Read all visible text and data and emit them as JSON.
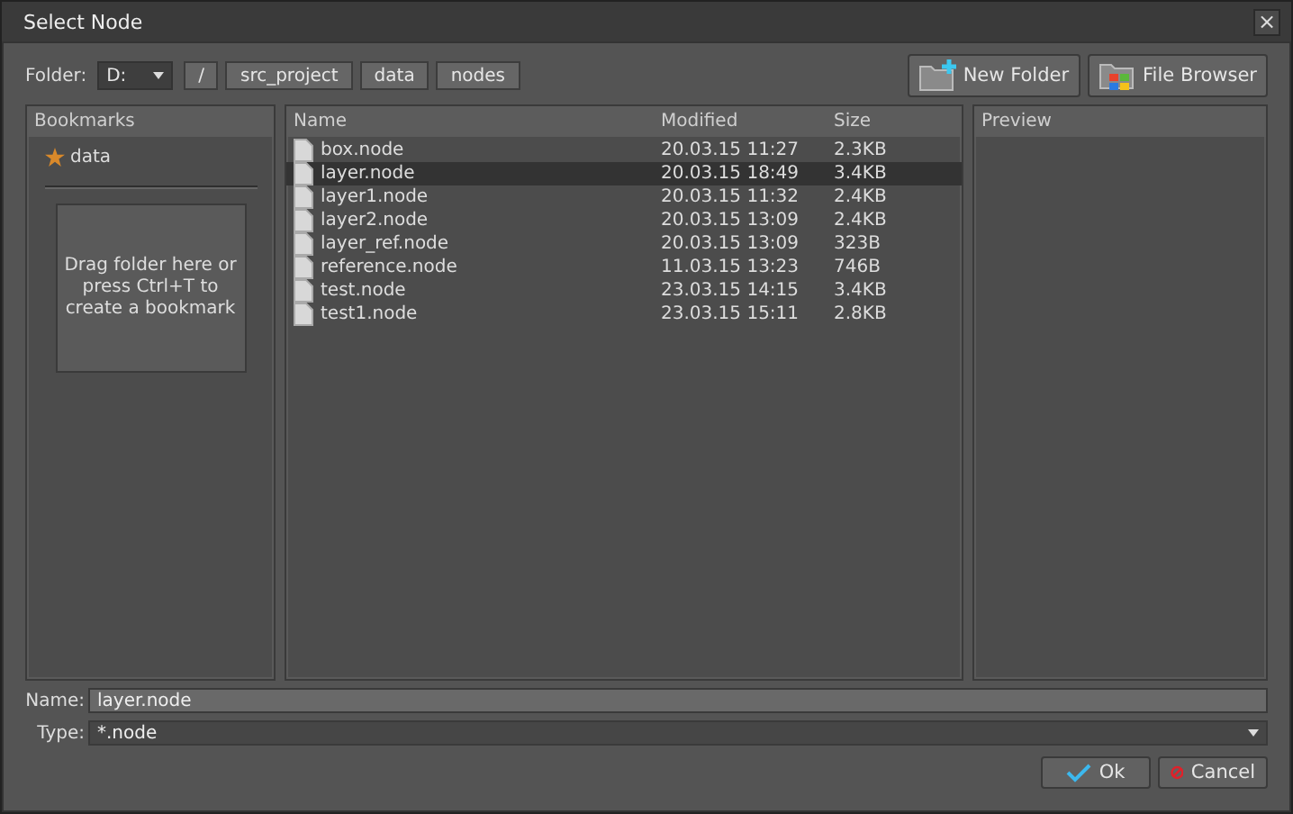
{
  "window": {
    "title": "Select Node",
    "close": "×"
  },
  "toolbar": {
    "folder_label": "Folder:",
    "drive": "D:",
    "path": [
      "/",
      "src_project",
      "data",
      "nodes"
    ],
    "buttons": [
      {
        "kind": "new-folder",
        "label": "New Folder"
      },
      {
        "kind": "file-browser",
        "label": "File Browser"
      }
    ]
  },
  "bookmarks": {
    "title": "Bookmarks",
    "items": [
      {
        "label": "data"
      }
    ],
    "drop_hint": "Drag folder here or press Ctrl+T to create a bookmark"
  },
  "table": {
    "columns": [
      "Name",
      "Modified",
      "Size"
    ],
    "rows": [
      {
        "name": "box.node",
        "modified": "20.03.15 11:27",
        "size": "2.3KB",
        "selected": false
      },
      {
        "name": "layer.node",
        "modified": "20.03.15 18:49",
        "size": "3.4KB",
        "selected": true
      },
      {
        "name": "layer1.node",
        "modified": "20.03.15 11:32",
        "size": "2.4KB",
        "selected": false
      },
      {
        "name": "layer2.node",
        "modified": "20.03.15 13:09",
        "size": "2.4KB",
        "selected": false
      },
      {
        "name": "layer_ref.node",
        "modified": "20.03.15 13:09",
        "size": "323B",
        "selected": false
      },
      {
        "name": "reference.node",
        "modified": "11.03.15 13:23",
        "size": "746B",
        "selected": false
      },
      {
        "name": "test.node",
        "modified": "23.03.15 14:15",
        "size": "3.4KB",
        "selected": false
      },
      {
        "name": "test1.node",
        "modified": "23.03.15 15:11",
        "size": "2.8KB",
        "selected": false
      }
    ]
  },
  "preview": {
    "title": "Preview"
  },
  "name_field": {
    "label": "Name:",
    "value": "layer.node"
  },
  "type_field": {
    "label": "Type:",
    "value": "*.node"
  },
  "buttons": [
    {
      "kind": "ok",
      "label": "Ok"
    },
    {
      "kind": "cancel",
      "label": "Cancel"
    }
  ]
}
